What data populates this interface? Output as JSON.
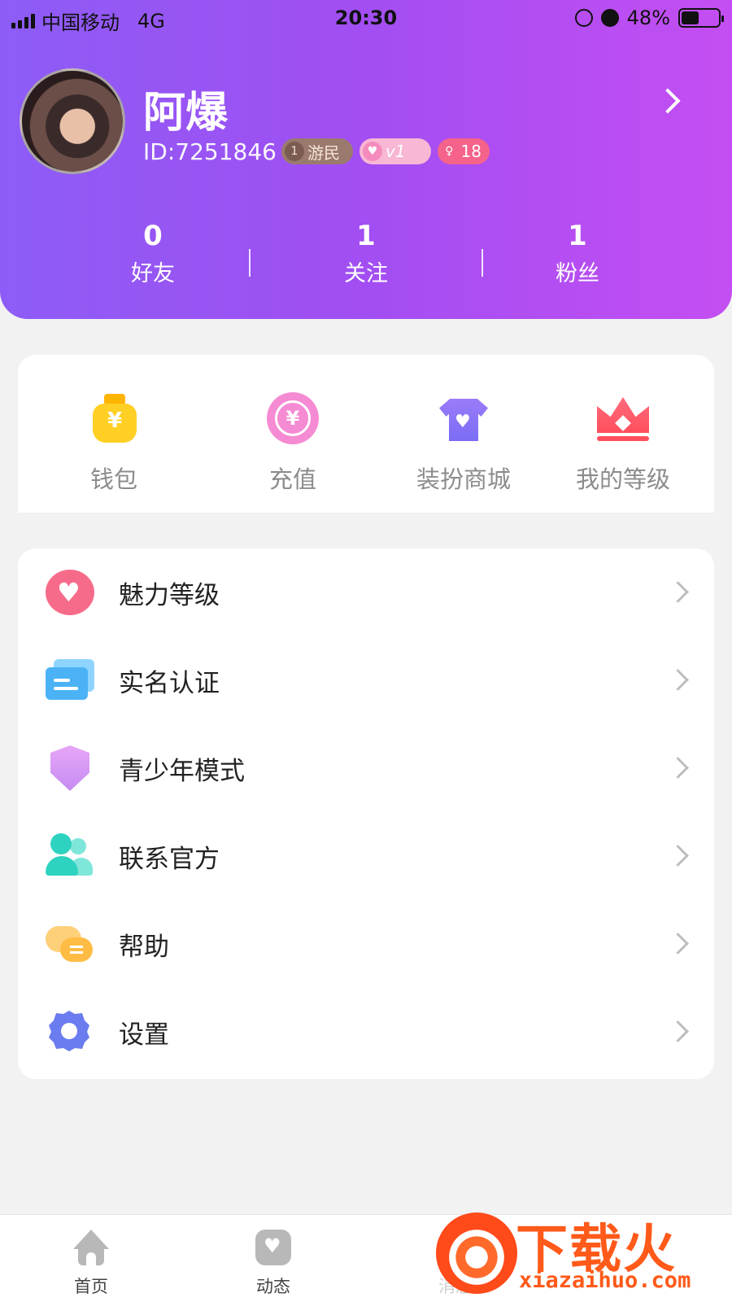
{
  "status_bar": {
    "carrier": "中国移动",
    "network": "4G",
    "time": "20:30",
    "battery": "48%",
    "battery_level": 0.48
  },
  "profile": {
    "username": "阿爆",
    "user_id": "ID:7251846",
    "badges": {
      "level_num": "1",
      "level_name": "游民",
      "vip": "v1",
      "age": "18"
    }
  },
  "stats": [
    {
      "count": "0",
      "label": "好友"
    },
    {
      "count": "1",
      "label": "关注"
    },
    {
      "count": "1",
      "label": "粉丝"
    }
  ],
  "quick_actions": [
    {
      "label": "钱包",
      "icon": "money-bag-icon"
    },
    {
      "label": "充值",
      "icon": "coin-icon"
    },
    {
      "label": "装扮商城",
      "icon": "shirt-icon"
    },
    {
      "label": "我的等级",
      "icon": "crown-icon"
    }
  ],
  "menu": [
    {
      "label": "魅力等级",
      "icon": "heart-icon"
    },
    {
      "label": "实名认证",
      "icon": "id-card-icon"
    },
    {
      "label": "青少年模式",
      "icon": "shield-icon"
    },
    {
      "label": "联系官方",
      "icon": "contacts-icon"
    },
    {
      "label": "帮助",
      "icon": "chat-bubbles-icon"
    },
    {
      "label": "设置",
      "icon": "gear-icon"
    }
  ],
  "bottom_nav": [
    {
      "label": "首页",
      "icon": "home-icon"
    },
    {
      "label": "动态",
      "icon": "heart-box-icon"
    },
    {
      "label": "消息",
      "icon": "message-icon"
    }
  ],
  "watermark": {
    "brand": "下载火",
    "url": "xiazaihuo.com"
  },
  "colors": {
    "header_start": "#8d5cf6",
    "header_end": "#c44ef2",
    "background": "#f2f2f2"
  }
}
